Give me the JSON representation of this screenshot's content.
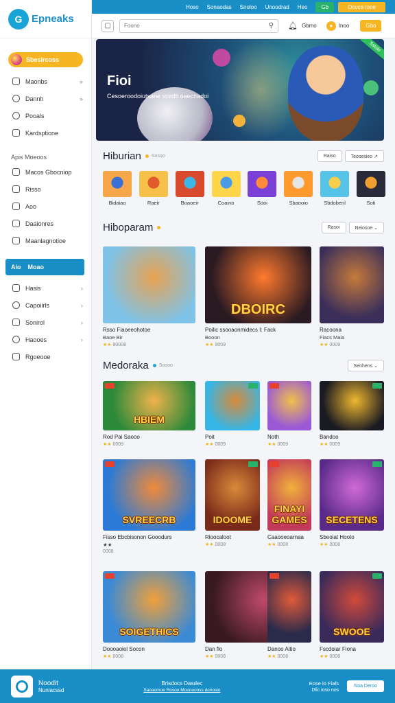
{
  "brand": {
    "logo_text": "Epneaks",
    "logo_glyph": "G"
  },
  "sidebar": {
    "highlight_label": "Sbesircoss",
    "items_top": [
      {
        "label": "Maonbs",
        "icon": "gamepad-icon"
      },
      {
        "label": "Dannh",
        "icon": "globe-icon"
      },
      {
        "label": "Pooals",
        "icon": "chat-icon"
      },
      {
        "label": "Kardsptione",
        "icon": "card-icon"
      }
    ],
    "section_label": "Apis Moeoos",
    "items_mid": [
      {
        "label": "Macos Gbocniop",
        "icon": "grid-icon"
      },
      {
        "label": "Risso",
        "icon": "list-icon"
      },
      {
        "label": "Aoo",
        "icon": "grid-icon"
      },
      {
        "label": "Daaionres",
        "icon": "list-icon"
      },
      {
        "label": "Maanlagnotioe",
        "icon": "grid-icon"
      }
    ],
    "active_label": "Aio",
    "active_label2": "Moao",
    "items_bottom": [
      {
        "label": "Hasis",
        "icon": "gamepad-icon",
        "chev": "›"
      },
      {
        "label": "Capoiirls",
        "icon": "chat-icon",
        "chev": "›"
      },
      {
        "label": "Sonirol",
        "icon": "card-icon",
        "chev": "›"
      },
      {
        "label": "Haooes",
        "icon": "clock-icon",
        "chev": "›"
      },
      {
        "label": "Rgoeooe",
        "icon": "play-icon",
        "chev": ""
      }
    ]
  },
  "topnav": {
    "links": [
      "Hoso",
      "Sonaodas",
      "Snoloo",
      "Unoodrad",
      "Heo"
    ],
    "pill_green": "Gb",
    "pill_yellow": "Ocuca tooe"
  },
  "search": {
    "placeholder": "Foono",
    "user_label": "Gbmo",
    "coin_label": "Inoo",
    "button": "Gbo"
  },
  "hero": {
    "title": "Fioi",
    "subtitle": "Cesoeroodoiutsane vcedti oaecnadoi",
    "badge": "Sslolo"
  },
  "section1": {
    "title": "Hiburian",
    "sub": "Sosoo",
    "btn1": "Raiso",
    "btn2": "Teosesieo ↗",
    "accent": "#f6b624"
  },
  "icons": [
    {
      "caption": "Bidaiao",
      "c1": "#f7a64a",
      "c2": "#3a6fd6"
    },
    {
      "caption": "Raeir",
      "c1": "#f7c04a",
      "c2": "#e05a2b"
    },
    {
      "caption": "Boaoeir",
      "c1": "#d84a2e",
      "c2": "#3cb6e6"
    },
    {
      "caption": "Coaino",
      "c1": "#ffd54a",
      "c2": "#4a9be6"
    },
    {
      "caption": "Sooi",
      "c1": "#7a3fd6",
      "c2": "#ff8a3a"
    },
    {
      "caption": "Sbaooio",
      "c1": "#ff9a2e",
      "c2": "#e6e6e6"
    },
    {
      "caption": "Sbdobenl",
      "c1": "#56c3e8",
      "c2": "#f6d04a"
    },
    {
      "caption": "Soti",
      "c1": "#2a2a3a",
      "c2": "#f0a030"
    }
  ],
  "section2": {
    "title": "Hiboparam",
    "btn1": "Rasoi",
    "btn2": "Neiosoe ⌄",
    "accent": "#f6b624"
  },
  "row1": [
    {
      "t1": "Rsso Fiaoeeohotoe",
      "t2": "Baoe Bir",
      "rating": "★★",
      "rcount": "90008",
      "c1": "#7fc3e8",
      "c2": "#e8a252",
      "label": ""
    },
    {
      "t1": "Poilic ssooaonmidecs I: Fack",
      "t2": "Booon",
      "rating": "★★",
      "rcount": "9009",
      "c1": "#2a1a22",
      "c2": "#ff7a2e",
      "label": "DBOIRC"
    },
    {
      "t1": "Racoona",
      "t2": "Fiacs Maia",
      "rating": "★★",
      "rcount": "0009",
      "c1": "#3b2f5a",
      "c2": "#c57a3a",
      "label": ""
    }
  ],
  "section3": {
    "title": "Medoraka",
    "sub": "Soooo",
    "btn": "Senhens ⌄",
    "accent": "#1aa3d6"
  },
  "row2": [
    {
      "t1": "Rod Pai Saooo",
      "rating": "★★",
      "rcount": "0009",
      "c1": "#2d8a3a",
      "c2": "#f0b24a",
      "label": "HBIEM"
    },
    {
      "t1": "Poit",
      "rating": "★★",
      "rcount": "0009",
      "c1": "#36b6e6",
      "c2": "#d88a3a",
      "label": ""
    },
    {
      "t1": "Noth",
      "rating": "★★",
      "rcount": "0009",
      "c1": "#9a5ad6",
      "c2": "#f0c04a",
      "label": ""
    },
    {
      "t1": "Bandoo",
      "rating": "★★",
      "rcount": "0009",
      "c1": "#1a1a22",
      "c2": "#f0b830",
      "label": ""
    }
  ],
  "row3": [
    {
      "t1": "Fisso Ebcbisonon Gooodurs",
      "t2": "★★",
      "rating": "",
      "rcount": "0008",
      "c1": "#2a7ad6",
      "c2": "#f08a3a",
      "label": "SVREECRB"
    },
    {
      "t1": "Rioocaloot",
      "rating": "★★",
      "rcount": "0008",
      "c1": "#7a2a1a",
      "c2": "#d88a3a",
      "label": "IDOOME"
    },
    {
      "t1": "Caaooeoarnaa",
      "rating": "★★",
      "rcount": "0008",
      "c1": "#c23a5a",
      "c2": "#f0b23a",
      "label": "FINAYI GAMES"
    },
    {
      "t1": "Sbeoiat Hooto",
      "rating": "★★",
      "rcount": "0008",
      "c1": "#5a2a8a",
      "c2": "#d06ad6",
      "label": "SECETENS"
    }
  ],
  "row4": [
    {
      "t1": "Doooaoiel Socon",
      "rating": "★★",
      "rcount": "0008",
      "c1": "#3a8ad6",
      "c2": "#f0a03a",
      "label": "SOIGETHICS"
    },
    {
      "t1": "Dan flo",
      "rating": "★★",
      "rcount": "0008",
      "c1": "#3a1a22",
      "c2": "#c04a6a",
      "label": ""
    },
    {
      "t1": "Danoo Aitio",
      "rating": "★★",
      "rcount": "0008",
      "c1": "#2a2a4a",
      "c2": "#e05a3a",
      "label": ""
    },
    {
      "t1": "Fscdoiar Fiona",
      "rating": "★★",
      "rcount": "0008",
      "c1": "#3a2a5a",
      "c2": "#d04a3a",
      "label": "SWOOE"
    }
  ],
  "footer": {
    "brand_a": "Noodit",
    "brand_b": "Nuniacssd",
    "mid_a": "Brisdocs Dasdec",
    "mid_b": "Saoaomoe Rosoo Mooooonss donosio",
    "right_a": "Eose lo Fiafs",
    "right_b": "Dlic ioso nos",
    "button": "Noa Deroo"
  }
}
